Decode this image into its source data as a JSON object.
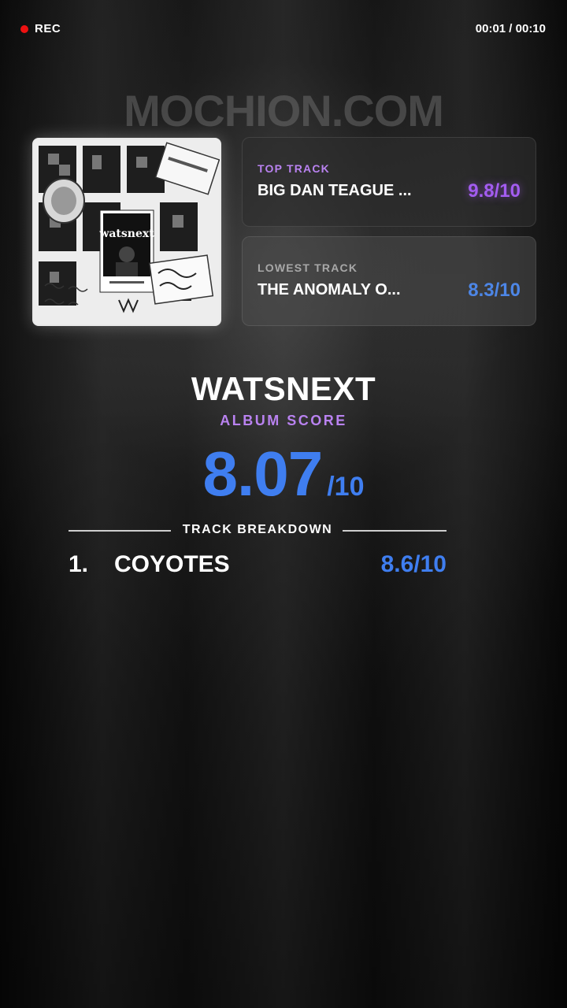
{
  "status": {
    "rec_label": "REC",
    "timer": "00:01 / 00:10"
  },
  "watermark": "MOCHION.COM",
  "album_art": {
    "cover_text": "watsnext"
  },
  "top_track": {
    "label": "TOP TRACK",
    "title": "BIG DAN TEAGUE ...",
    "score": "9.8/10"
  },
  "lowest_track": {
    "label": "LOWEST TRACK",
    "title": "THE ANOMALY O...",
    "score": "8.3/10"
  },
  "album": {
    "title": "WATSNEXT",
    "score_label": "ALBUM SCORE",
    "score": "8.07",
    "score_out_of": "/10"
  },
  "breakdown": {
    "label": "TRACK BREAKDOWN",
    "tracks": [
      {
        "number": "1.",
        "name": "COYOTES",
        "score": "8.6/10"
      }
    ]
  },
  "colors": {
    "accent_purple": "#a35cf0",
    "accent_blue": "#3f7ef0",
    "rec_red": "#ee1111"
  }
}
